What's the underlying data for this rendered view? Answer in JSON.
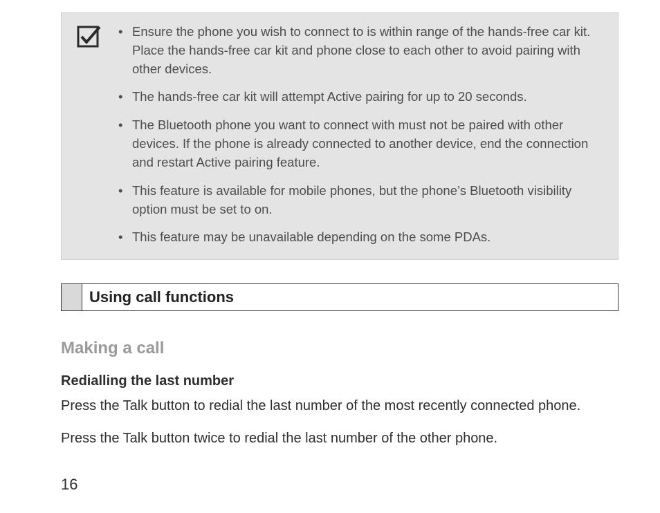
{
  "note": {
    "icon": "checkbox-checked-icon",
    "items": [
      "Ensure the phone you wish to connect to is within range of the hands-free car kit. Place the hands-free car kit and phone close to each other to avoid pairing with other devices.",
      "The hands-free car kit will attempt Active pairing for up to 20 seconds.",
      "The Bluetooth phone you want to connect with must not be paired with other devices. If the phone is already connected to another device, end the connection and restart Active pairing feature.",
      "This feature is available for mobile phones, but the phone’s Bluetooth visibility option must be set to on.",
      "This feature may be unavailable depending on the some PDAs."
    ]
  },
  "section": {
    "title": "Using call functions"
  },
  "subheading": "Making a call",
  "subsub": "Redialling the last number",
  "paragraphs": [
    "Press the Talk button to redial the last number of the most recently connected phone.",
    "Press the Talk button twice to redial the last number of the other phone."
  ],
  "page_number": "16"
}
